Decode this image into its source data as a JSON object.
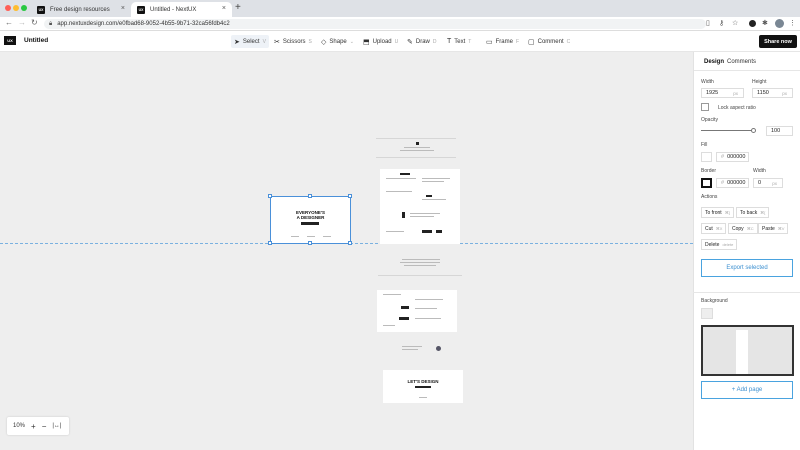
{
  "browser": {
    "tabs": [
      {
        "label": "Free design resources",
        "favicon": "UX"
      },
      {
        "label": "Untitled - NextUX",
        "favicon": "UX"
      }
    ],
    "url": "app.nextuxdesign.com/e0fbad68-9052-4b55-9b71-32ca56fdb4c2"
  },
  "app": {
    "logo": "UX",
    "title": "Untitled",
    "tools": [
      {
        "label": "Select",
        "shortcut": "V",
        "icon": "cursor-icon"
      },
      {
        "label": "Scissors",
        "shortcut": "S",
        "icon": "scissors-icon"
      },
      {
        "label": "Shape",
        "shortcut": "",
        "icon": "shape-icon"
      },
      {
        "label": "Upload",
        "shortcut": "U",
        "icon": "upload-icon"
      },
      {
        "label": "Draw",
        "shortcut": "D",
        "icon": "pencil-icon"
      },
      {
        "label": "Text",
        "shortcut": "T",
        "icon": "text-icon"
      },
      {
        "label": "Frame",
        "shortcut": "F",
        "icon": "frame-icon"
      },
      {
        "label": "Comment",
        "shortcut": "C",
        "icon": "comment-icon"
      }
    ],
    "share_label": "Share now"
  },
  "canvas": {
    "artboard_texts": [
      "EVERYONE'S",
      "A DESIGNER",
      "LET'S DESIGN"
    ],
    "zoom": "10%"
  },
  "panel": {
    "tabs": [
      "Design",
      "Comments"
    ],
    "width_label": "Width",
    "width_value": "1925",
    "width_unit": "px",
    "height_label": "Height",
    "height_value": "1150",
    "height_unit": "px",
    "lock_label": "Lock aspect ratio",
    "opacity_label": "Opacity",
    "opacity_value": "100",
    "fill_label": "Fill",
    "fill_hash": "#",
    "fill_value": "000000",
    "border_label": "Border",
    "border_hash": "#",
    "border_value": "000000",
    "border_width_label": "Width",
    "border_width_value": "0",
    "border_width_unit": "px",
    "actions_label": "Actions",
    "actions": [
      {
        "label": "To front",
        "shortcut": "⌘]"
      },
      {
        "label": "To back",
        "shortcut": "⌘["
      },
      {
        "label": "Cut",
        "shortcut": "⌘X"
      },
      {
        "label": "Copy",
        "shortcut": "⌘C"
      },
      {
        "label": "Paste",
        "shortcut": "⌘V"
      },
      {
        "label": "Delete",
        "shortcut": "delete"
      }
    ],
    "export_label": "Export selected",
    "background_label": "Background",
    "add_page_label": "+ Add page"
  }
}
